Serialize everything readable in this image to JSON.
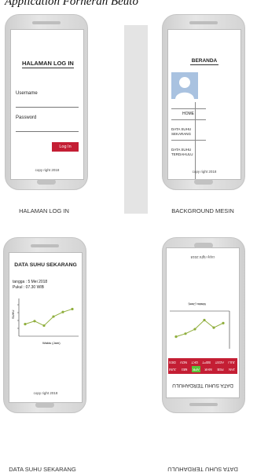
{
  "heading": "Application Fornerah Beuto",
  "screens": {
    "login": {
      "title": "HALAMAN LOG IN",
      "username_label": "Username",
      "password_label": "Password",
      "login_button": "Log In",
      "footer": "copy right 2018",
      "caption": "HALAMAN LOG IN"
    },
    "beranda": {
      "title": "BERANDA",
      "menu": [
        "HOME",
        "DATA SUHU SEKARANG",
        "DATA SUHU TERDAHULU"
      ],
      "footer": "copy right 2018",
      "caption": "BACKGROUND MESIN"
    },
    "sekarang": {
      "title": "DATA SUHU SEKARANG",
      "date_line": "tangga : 5 Mei 2018",
      "time_line": "Pukul : 07.30 WIB",
      "footer": "copy right 2018",
      "caption": "DATA SUHU SEKARANG",
      "chart_data": {
        "type": "line",
        "x": [
          1,
          2,
          3,
          4,
          5,
          6
        ],
        "values": [
          28,
          30,
          27,
          33,
          36,
          38
        ],
        "xlabel": "Waktu (Jam)",
        "ylabel": "SUHU",
        "ylim": [
          20,
          45
        ],
        "color": "#8fae3c"
      }
    },
    "terdahulu": {
      "title": "DATA SUHU TERDAHULU",
      "months_row1": [
        "JAN",
        "FEB",
        "MAR",
        "APR",
        "MEI",
        "JUNI"
      ],
      "months_row2": [
        "JULI",
        "AGST",
        "SEPT",
        "OKT",
        "NOV",
        "DES"
      ],
      "active_month": "APR",
      "footer": "copy right 2018",
      "caption": "DATA SUHU TERDAHULU",
      "chart_data": {
        "type": "line",
        "x": [
          1,
          2,
          3,
          4,
          5,
          6
        ],
        "values": [
          28,
          31,
          26,
          32,
          35,
          37
        ],
        "xlabel": "Waktu (Jam)",
        "ylim": [
          20,
          45
        ],
        "color": "#8fae3c"
      }
    }
  },
  "colors": {
    "red": "#c41e34",
    "green": "#5ac33a",
    "line": "#8fae3c"
  }
}
